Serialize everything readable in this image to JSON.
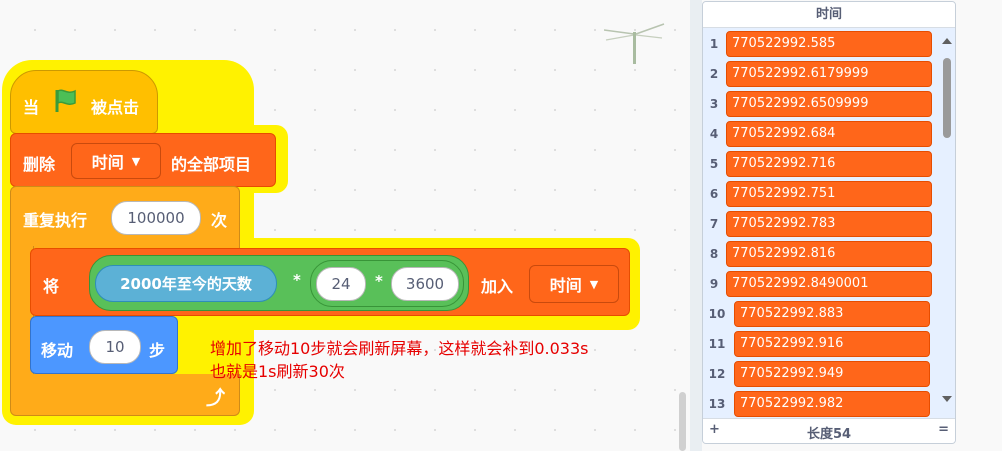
{
  "blocks": {
    "hat": {
      "when": "当",
      "clicked": "被点击"
    },
    "delete": {
      "label": "删除",
      "list": "时间",
      "suffix": "的全部项目"
    },
    "repeat": {
      "label": "重复执行",
      "count": "100000",
      "suffix": "次"
    },
    "add": {
      "label": "将",
      "reporter": "2000年至今的天数",
      "op1": "*",
      "num1": "24",
      "op2": "*",
      "num2": "3600",
      "join": "加入",
      "list": "时间"
    },
    "move": {
      "label": "移动",
      "steps": "10",
      "suffix": "步"
    },
    "loop_arrow": "⤴"
  },
  "annotation": {
    "line1": "增加了移动10步就会刷新屏幕，这样就会补到0.033s",
    "line2": "也就是1s刷新30次"
  },
  "monitor": {
    "title": "时间",
    "items": [
      {
        "index": "1",
        "value": "770522992.585"
      },
      {
        "index": "2",
        "value": "770522992.6179999"
      },
      {
        "index": "3",
        "value": "770522992.6509999"
      },
      {
        "index": "4",
        "value": "770522992.684"
      },
      {
        "index": "5",
        "value": "770522992.716"
      },
      {
        "index": "6",
        "value": "770522992.751"
      },
      {
        "index": "7",
        "value": "770522992.783"
      },
      {
        "index": "8",
        "value": "770522992.816"
      },
      {
        "index": "9",
        "value": "770522992.8490001"
      },
      {
        "index": "10",
        "value": "770522992.883"
      },
      {
        "index": "11",
        "value": "770522992.916"
      },
      {
        "index": "12",
        "value": "770522992.949"
      },
      {
        "index": "13",
        "value": "770522992.982"
      }
    ],
    "add_label": "+",
    "length_label": "长度54",
    "resize_label": "="
  },
  "colors": {
    "event": "#ffbf00",
    "control": "#ffab19",
    "list": "#ff661a",
    "motion": "#4c97ff",
    "operator": "#59c059",
    "sensing": "#5cb1d6",
    "glow": "#fff200"
  }
}
